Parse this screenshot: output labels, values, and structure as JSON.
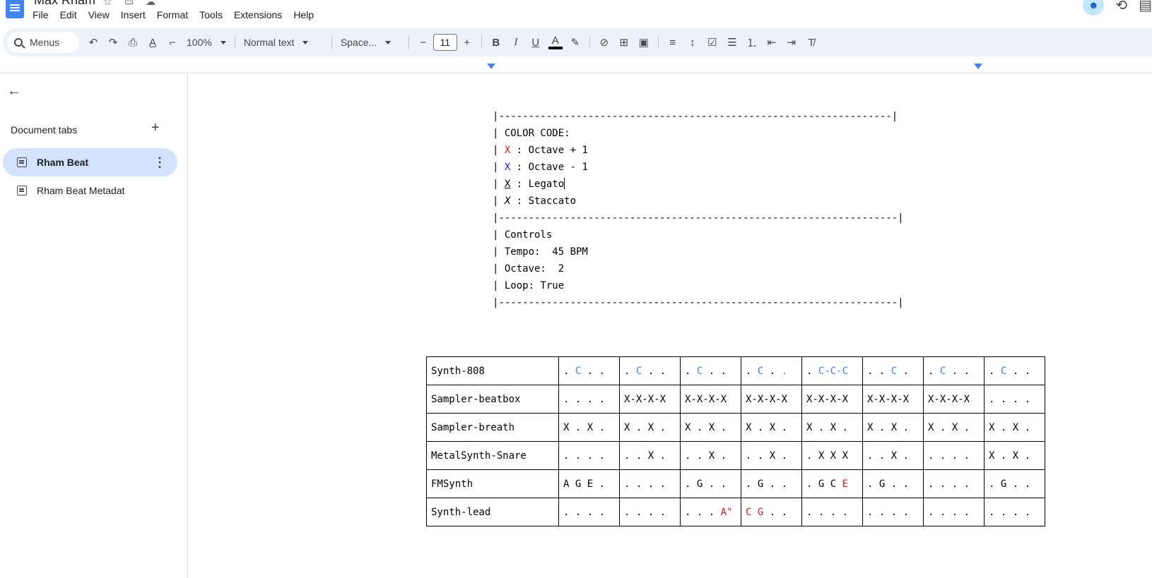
{
  "app": {
    "title": "Max Rham",
    "menus": [
      "File",
      "Edit",
      "View",
      "Insert",
      "Format",
      "Tools",
      "Extensions",
      "Help"
    ]
  },
  "toolbar": {
    "search_placeholder": "Menus",
    "zoom": "100%",
    "style": "Normal text",
    "font": "Space...",
    "font_size": "11",
    "text_color": "#000000"
  },
  "sidebar": {
    "header": "Document tabs",
    "tabs": [
      {
        "label": "Rham Beat",
        "active": true
      },
      {
        "label": "Rham Beat Metadat",
        "active": false
      }
    ]
  },
  "document": {
    "separator_top": "|------------------------------------------------------------------|",
    "color_code_title": "| COLOR CODE:",
    "legend": {
      "prefix": "| ",
      "marker": "X",
      "octave_up": " : Octave + 1",
      "octave_down": " : Octave - 1",
      "legato": " : Legato",
      "staccato": " : Staccato"
    },
    "separator_mid": "|-------------------------------------------------------------------|",
    "controls_title": "| Controls",
    "tempo": "| Tempo:  45 BPM",
    "octave": "| Octave:  2",
    "loop": "| Loop: True",
    "separator_bottom": "|-------------------------------------------------------------------|"
  },
  "colors": {
    "octave_up": "#e81416",
    "octave_down": "#1a1aff",
    "link_blue": "#3b82f6"
  },
  "table": {
    "rows": [
      {
        "name": "Synth-808",
        "cells": [
          [
            {
              "t": ". "
            },
            {
              "t": "C",
              "c": "lblue"
            },
            {
              "t": " . ."
            }
          ],
          [
            {
              "t": ". "
            },
            {
              "t": "C",
              "c": "lblue"
            },
            {
              "t": " . ."
            }
          ],
          [
            {
              "t": ". "
            },
            {
              "t": "C",
              "c": "lblue"
            },
            {
              "t": " . ."
            }
          ],
          [
            {
              "t": ". "
            },
            {
              "t": "C",
              "c": "lblue"
            },
            {
              "t": " . "
            },
            {
              "t": ".",
              "c": "lblue"
            }
          ],
          [
            {
              "t": ". "
            },
            {
              "t": "C-C-C",
              "c": "lblue"
            }
          ],
          [
            {
              "t": ". . "
            },
            {
              "t": "C",
              "c": "lblue"
            },
            {
              "t": " ."
            }
          ],
          [
            {
              "t": ". "
            },
            {
              "t": "C",
              "c": "lblue"
            },
            {
              "t": " . ."
            }
          ],
          [
            {
              "t": ". "
            },
            {
              "t": "C",
              "c": "lblue"
            },
            {
              "t": " . ."
            }
          ]
        ]
      },
      {
        "name": "Sampler-beatbox",
        "cells": [
          [
            {
              "t": ". . . ."
            }
          ],
          [
            {
              "t": "X-X-X-X"
            }
          ],
          [
            {
              "t": "X-X-X-X"
            }
          ],
          [
            {
              "t": "X-X-X-X"
            }
          ],
          [
            {
              "t": "X-X-X-X"
            }
          ],
          [
            {
              "t": "X-X-X-X"
            }
          ],
          [
            {
              "t": "X-X-X-X"
            }
          ],
          [
            {
              "t": ". . . ."
            }
          ]
        ]
      },
      {
        "name": "Sampler-breath",
        "cells": [
          [
            {
              "t": "X . X ."
            }
          ],
          [
            {
              "t": "X . X ."
            }
          ],
          [
            {
              "t": "X . X ."
            }
          ],
          [
            {
              "t": "X . X ."
            }
          ],
          [
            {
              "t": "X . X ."
            }
          ],
          [
            {
              "t": "X . X ."
            }
          ],
          [
            {
              "t": "X . X ."
            }
          ],
          [
            {
              "t": "X . X ."
            }
          ]
        ]
      },
      {
        "name": "MetalSynth-Snare",
        "cells": [
          [
            {
              "t": ". . . ."
            }
          ],
          [
            {
              "t": ". . X ."
            }
          ],
          [
            {
              "t": ". . X ."
            }
          ],
          [
            {
              "t": ". . X ."
            }
          ],
          [
            {
              "t": ". X X X"
            }
          ],
          [
            {
              "t": ". . X ."
            }
          ],
          [
            {
              "t": ". . . ."
            }
          ],
          [
            {
              "t": "X . X ."
            }
          ]
        ]
      },
      {
        "name": "FMSynth",
        "cells": [
          [
            {
              "t": "A G E ."
            }
          ],
          [
            {
              "t": ". . . ."
            }
          ],
          [
            {
              "t": ". G . ."
            }
          ],
          [
            {
              "t": ". G . ."
            }
          ],
          [
            {
              "t": ". G C "
            },
            {
              "t": "E",
              "c": "red"
            }
          ],
          [
            {
              "t": ". G . ."
            }
          ],
          [
            {
              "t": ". . . ."
            }
          ],
          [
            {
              "t": ". G . ."
            }
          ]
        ]
      },
      {
        "name": "Synth-lead",
        "cells": [
          [
            {
              "t": ". . . ."
            }
          ],
          [
            {
              "t": ". . . ."
            }
          ],
          [
            {
              "t": ". . . "
            },
            {
              "t": "A\"",
              "c": "red"
            }
          ],
          [
            {
              "t": "C G",
              "c": "red"
            },
            {
              "t": " . ."
            }
          ],
          [
            {
              "t": ". . . ."
            }
          ],
          [
            {
              "t": ". . . ."
            }
          ],
          [
            {
              "t": ". . . ."
            }
          ],
          [
            {
              "t": ". . . ."
            }
          ]
        ]
      }
    ]
  }
}
